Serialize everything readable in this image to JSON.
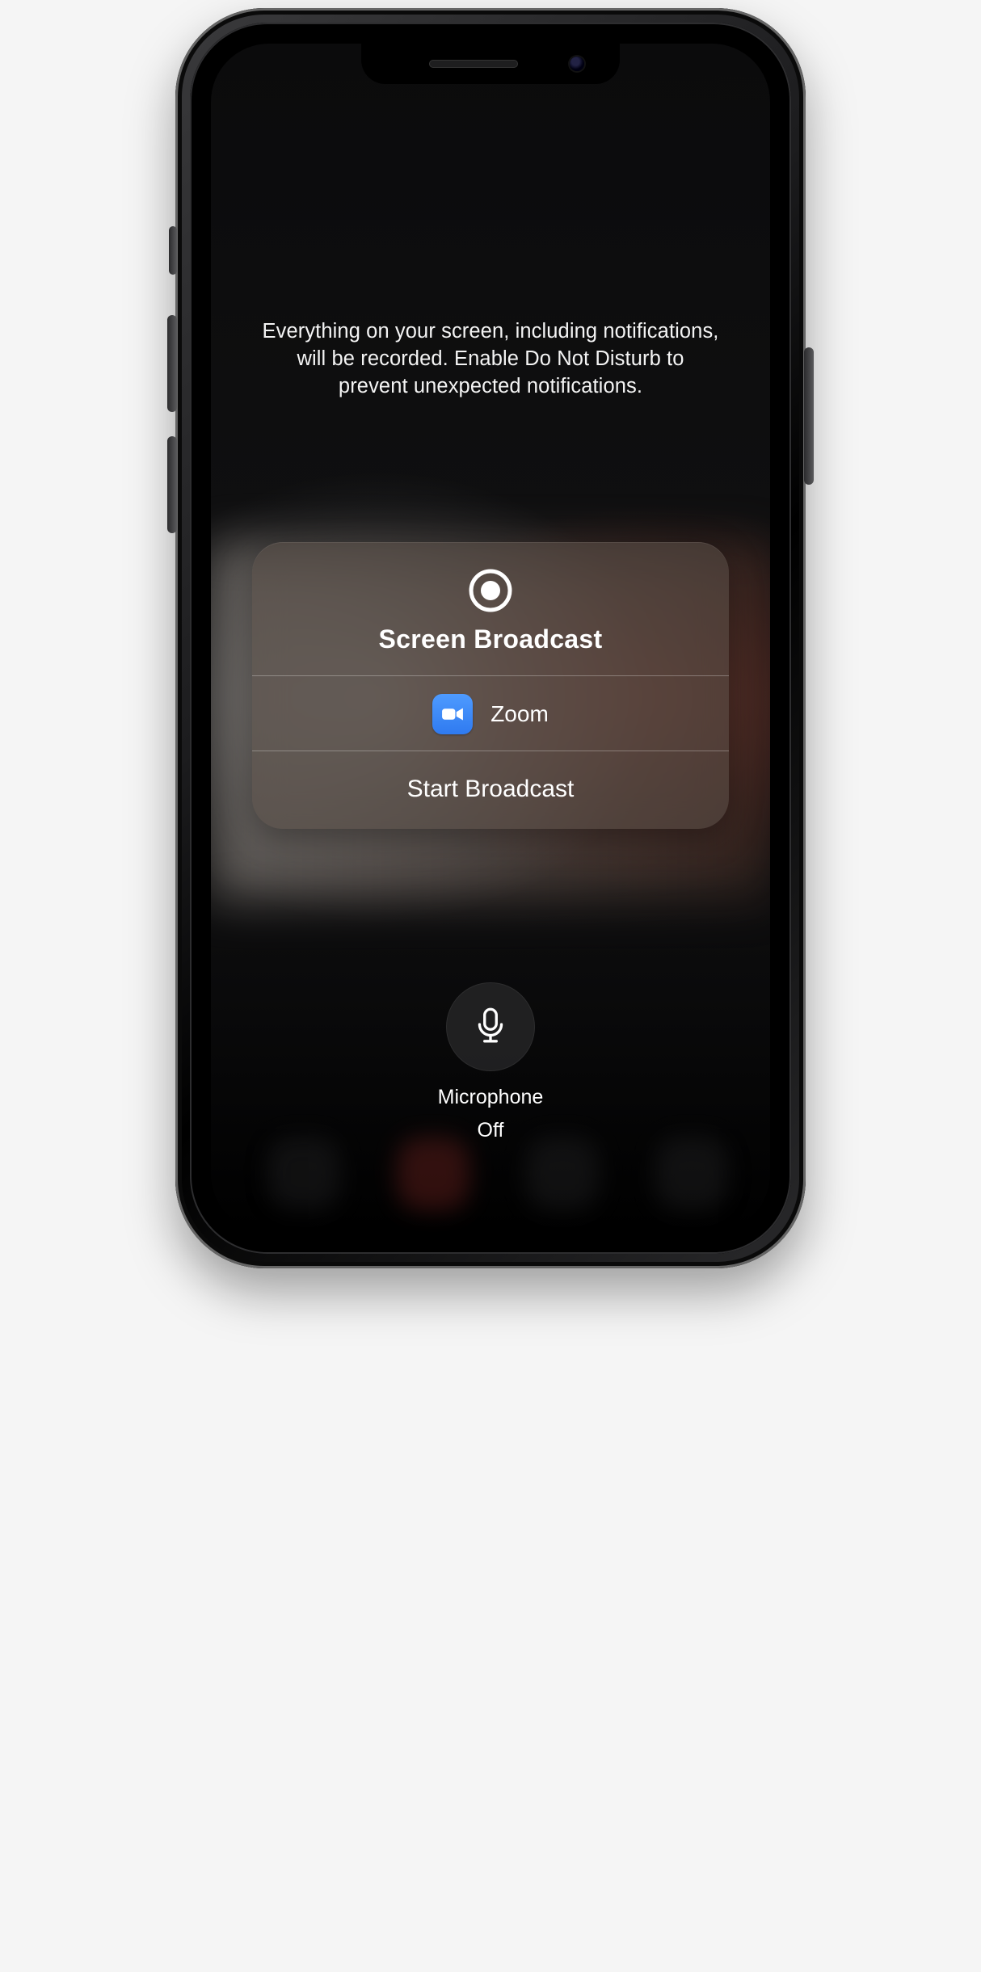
{
  "warning_text": "Everything on your screen, including notifications, will be recorded. Enable Do Not Disturb to prevent unexpected notifications.",
  "card": {
    "title": "Screen Broadcast",
    "app_name": "Zoom",
    "start_label": "Start Broadcast"
  },
  "mic": {
    "label": "Microphone",
    "state": "Off"
  },
  "icons": {
    "record": "record-icon",
    "zoom": "zoom-icon",
    "mic": "microphone-icon"
  },
  "colors": {
    "zoom_bg": "#3b82f6",
    "text": "#ffffff"
  }
}
